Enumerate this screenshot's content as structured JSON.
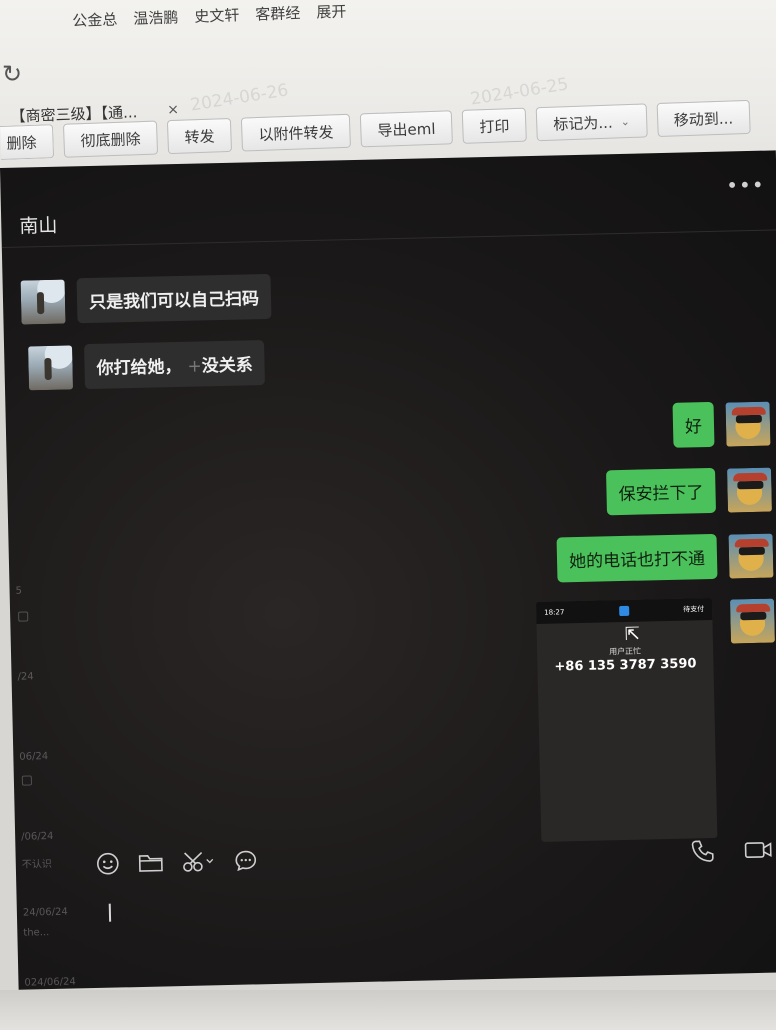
{
  "mail": {
    "recipients": [
      "公金总",
      "温浩鹏",
      "史文轩",
      "客群经",
      "展开"
    ],
    "refresh_icon": "↻",
    "watermarks": [
      "2024-06-26",
      "2024-06-25"
    ],
    "tab": {
      "title": "【商密三级】【通...",
      "close": "×"
    },
    "toolbar": {
      "delete": "删除",
      "delete_permanent": "彻底删除",
      "forward": "转发",
      "forward_as_attachment": "以附件转发",
      "export_eml": "导出eml",
      "print": "打印",
      "mark_as": "标记为...",
      "move_to": "移动到..."
    }
  },
  "chat": {
    "contact_name": "南山",
    "more": "•••",
    "left_list_fragments": [
      "5",
      "/24",
      "06/24",
      "/06/24",
      "不认识",
      "24/06/24",
      "the...",
      "024/06/24"
    ],
    "messages_in": [
      {
        "text": "只是我们可以自己扫码"
      },
      {
        "text_before": "你打给她，",
        "plus": "+",
        "text_after": "没关系"
      }
    ],
    "messages_out": [
      {
        "text": "好"
      },
      {
        "text": "保安拦下了"
      },
      {
        "text": "她的电话也打不通"
      }
    ],
    "screenshot": {
      "time": "18:27",
      "app": "待支付",
      "status": "用户正忙",
      "number": "+86 135 3787 3590"
    },
    "input_tools": [
      "emoji-icon",
      "folder-icon",
      "scissors-icon",
      "chat-bubble-icon"
    ],
    "call_tools": [
      "phone-icon",
      "video-icon"
    ]
  }
}
